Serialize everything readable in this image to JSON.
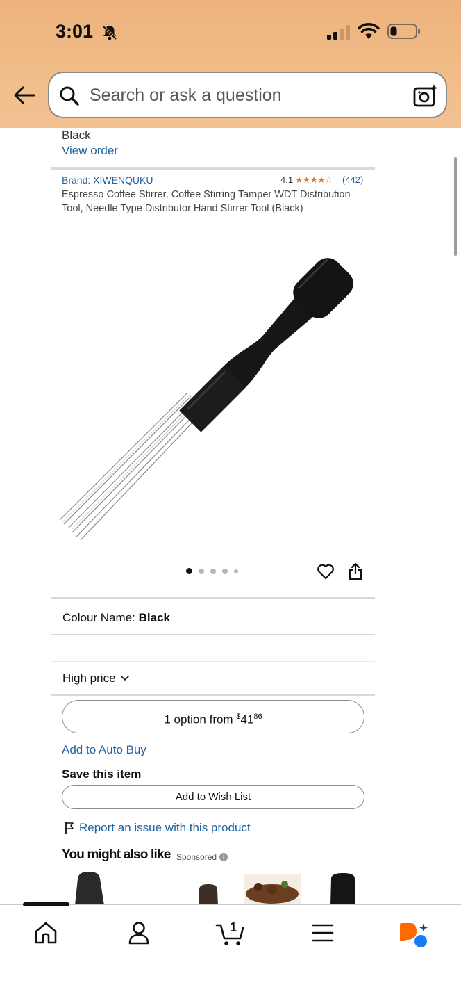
{
  "status_bar": {
    "time": "3:01"
  },
  "search": {
    "placeholder": "Search or ask a question"
  },
  "order_info": {
    "colour": "Black",
    "view_order": "View order"
  },
  "product": {
    "brand": "Brand: XIWENQUKU",
    "rating": "4.1",
    "stars": "★★★★☆",
    "review_count": "(442)",
    "title": "Espresso Coffee Stirrer, Coffee Stirring Tamper WDT Distribution Tool, Needle Type Distributor Hand Stirrer Tool (Black)"
  },
  "gallery": {
    "image_count": 5,
    "active_index": 0
  },
  "colour": {
    "label": "Colour Name: ",
    "value": "Black"
  },
  "sort": {
    "label": "High price"
  },
  "option_button": {
    "prefix": "1 option from ",
    "currency": "$",
    "whole": "41",
    "fraction": "86"
  },
  "auto_buy": {
    "label": "Add to Auto Buy"
  },
  "save": {
    "title": "Save this item",
    "wish_list_label": "Add to Wish List"
  },
  "report": {
    "label": "Report an issue with this product"
  },
  "recommendations": {
    "title": "You might also like",
    "sponsored": "Sponsored"
  },
  "colors": {
    "header": "#efb681",
    "link": "#2162a1",
    "star": "#de7921",
    "ai_orange": "#ff6a00",
    "ai_blue": "#1a7cf5"
  },
  "bottom_nav": {
    "items": [
      {
        "icon": "home-icon",
        "active": true
      },
      {
        "icon": "account-icon"
      },
      {
        "icon": "cart-icon",
        "count": "1"
      },
      {
        "icon": "menu-icon"
      },
      {
        "icon": "rufus-ai-icon"
      }
    ]
  }
}
